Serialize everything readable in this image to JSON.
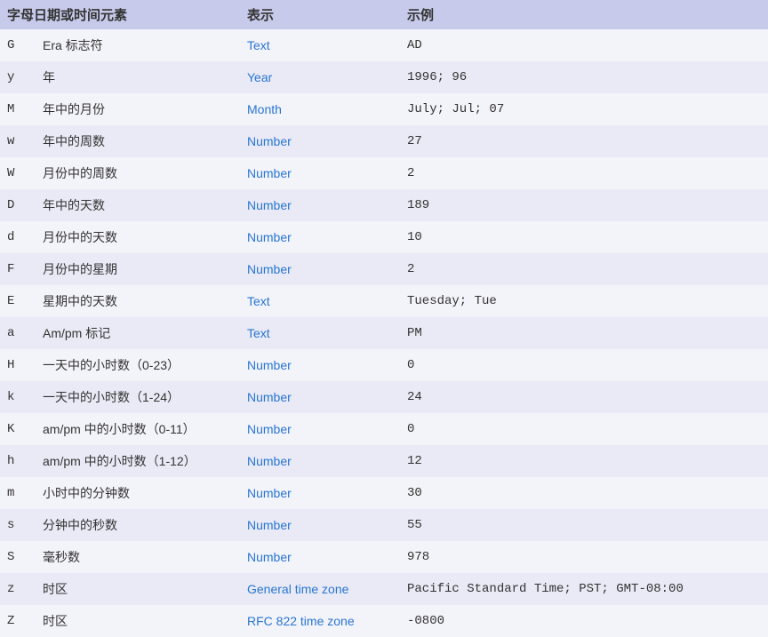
{
  "headers": {
    "col1": "字母日期或时间元素",
    "col2": "表示",
    "col3": "示例"
  },
  "rows": [
    {
      "letter": "G",
      "desc": "Era 标志符",
      "repr": "Text",
      "example": "AD"
    },
    {
      "letter": "y",
      "desc": "年",
      "repr": "Year",
      "example": "1996; 96"
    },
    {
      "letter": "M",
      "desc": "年中的月份",
      "repr": "Month",
      "example": "July; Jul; 07"
    },
    {
      "letter": "w",
      "desc": "年中的周数",
      "repr": "Number",
      "example": "27"
    },
    {
      "letter": "W",
      "desc": "月份中的周数",
      "repr": "Number",
      "example": "2"
    },
    {
      "letter": "D",
      "desc": "年中的天数",
      "repr": "Number",
      "example": "189"
    },
    {
      "letter": "d",
      "desc": "月份中的天数",
      "repr": "Number",
      "example": "10"
    },
    {
      "letter": "F",
      "desc": "月份中的星期",
      "repr": "Number",
      "example": "2"
    },
    {
      "letter": "E",
      "desc": "星期中的天数",
      "repr": "Text",
      "example": "Tuesday; Tue"
    },
    {
      "letter": "a",
      "desc": "Am/pm 标记",
      "repr": "Text",
      "example": "PM"
    },
    {
      "letter": "H",
      "desc": "一天中的小时数（0-23）",
      "repr": "Number",
      "example": "0"
    },
    {
      "letter": "k",
      "desc": "一天中的小时数（1-24）",
      "repr": "Number",
      "example": "24"
    },
    {
      "letter": "K",
      "desc": "am/pm 中的小时数（0-11）",
      "repr": "Number",
      "example": "0"
    },
    {
      "letter": "h",
      "desc": "am/pm 中的小时数（1-12）",
      "repr": "Number",
      "example": "12"
    },
    {
      "letter": "m",
      "desc": "小时中的分钟数",
      "repr": "Number",
      "example": "30"
    },
    {
      "letter": "s",
      "desc": "分钟中的秒数",
      "repr": "Number",
      "example": "55"
    },
    {
      "letter": "S",
      "desc": "毫秒数",
      "repr": "Number",
      "example": "978"
    },
    {
      "letter": "z",
      "desc": "时区",
      "repr": "General time zone",
      "example": "Pacific Standard Time; PST; GMT-08:00"
    },
    {
      "letter": "Z",
      "desc": "时区",
      "repr": "RFC 822 time zone",
      "example": "-0800"
    }
  ]
}
